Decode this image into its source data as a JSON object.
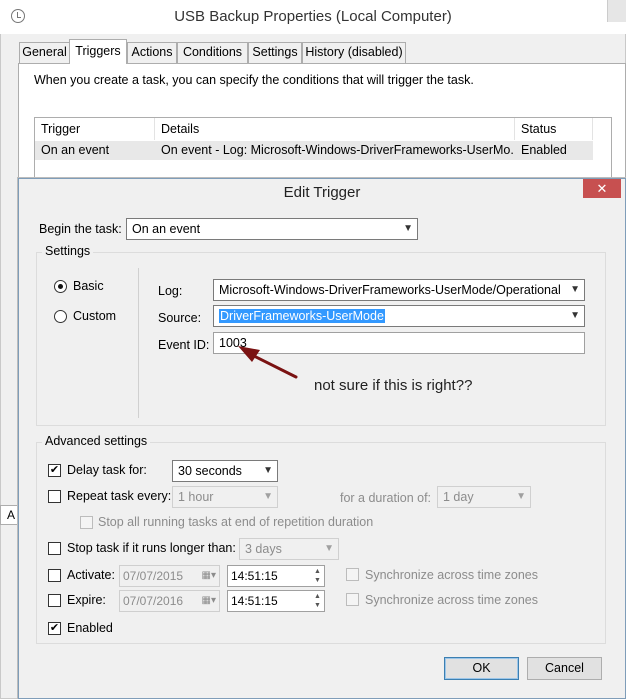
{
  "background_window": {
    "title": "USB Backup Properties (Local Computer)",
    "tabs": [
      "General",
      "Triggers",
      "Actions",
      "Conditions",
      "Settings",
      "History (disabled)"
    ],
    "active_tab": "Triggers",
    "description": "When you create a task, you can specify the conditions that will trigger the task.",
    "table": {
      "columns": [
        "Trigger",
        "Details",
        "Status"
      ],
      "rows": [
        [
          "On an event",
          "On event - Log: Microsoft-Windows-DriverFrameworks-UserMo...",
          "Enabled"
        ]
      ]
    },
    "bottom_strip_text": "A"
  },
  "dialog": {
    "title": "Edit Trigger",
    "close_glyph": "✕",
    "begin_label": "Begin the task:",
    "begin_value": "On an event",
    "settings_title": "Settings",
    "radios": [
      {
        "label": "Basic",
        "checked": true
      },
      {
        "label": "Custom",
        "checked": false
      }
    ],
    "log_label": "Log:",
    "log_value": "Microsoft-Windows-DriverFrameworks-UserMode/Operational",
    "source_label": "Source:",
    "source_value": "DriverFrameworks-UserMode",
    "event_id_label": "Event ID:",
    "event_id_value": "1003",
    "advanced_title": "Advanced settings",
    "delay": {
      "label": "Delay task for:",
      "checked": true,
      "value": "30 seconds"
    },
    "repeat": {
      "label": "Repeat task every:",
      "checked": false,
      "value": "1 hour",
      "duration_label": "for a duration of:",
      "duration_value": "1 day"
    },
    "stop_repetition": {
      "label": "Stop all running tasks at end of repetition duration",
      "checked": false
    },
    "stop_longer": {
      "label": "Stop task if it runs longer than:",
      "checked": false,
      "value": "3 days"
    },
    "activate": {
      "label": "Activate:",
      "checked": false,
      "date": "07/07/2015",
      "time": "14:51:15",
      "sync_label": "Synchronize across time zones"
    },
    "expire": {
      "label": "Expire:",
      "checked": false,
      "date": "07/07/2016",
      "time": "14:51:15",
      "sync_label": "Synchronize across time zones"
    },
    "enabled": {
      "label": "Enabled",
      "checked": true
    },
    "ok_label": "OK",
    "cancel_label": "Cancel"
  },
  "annotation": {
    "text": "not sure if this is right??",
    "arrow_color": "#7a1212"
  },
  "colors": {
    "selection": "#3399ff",
    "close_button": "#c75050"
  },
  "icons": {
    "window_icon": "clock-icon",
    "dropdown": "chevron-down-icon",
    "checkmark": "check-icon",
    "calendar": "calendar-icon",
    "spinner": "spin-arrows-icon"
  }
}
